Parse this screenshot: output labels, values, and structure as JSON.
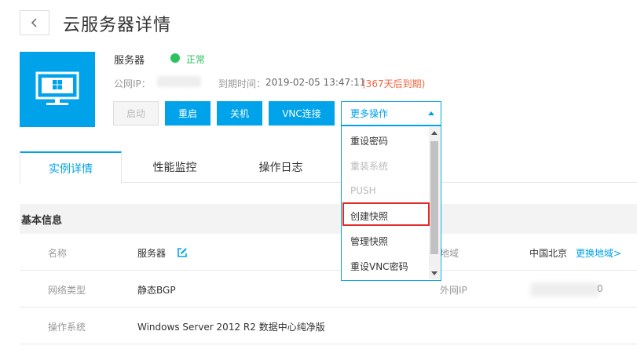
{
  "header": {
    "title": "云服务器详情"
  },
  "server": {
    "name": "服务器",
    "status": "正常",
    "ip_label": "公网IP：",
    "expire_label": "到期时间：",
    "expire_value": "2019-02-05 13:47:11",
    "expire_warn": "(367天后到期)"
  },
  "actions": {
    "start": "启动",
    "restart": "重启",
    "shutdown": "关机",
    "vnc": "VNC连接",
    "more": "更多操作"
  },
  "dropdown": {
    "items": [
      {
        "label": "重设密码",
        "disabled": false
      },
      {
        "label": "重装系统",
        "disabled": true
      },
      {
        "label": "PUSH",
        "disabled": true
      },
      {
        "label": "创建快照",
        "disabled": false
      },
      {
        "label": "管理快照",
        "disabled": false
      },
      {
        "label": "重设VNC密码",
        "disabled": false
      }
    ]
  },
  "tabs": [
    "实例详情",
    "性能监控",
    "操作日志"
  ],
  "section": {
    "title": "基本信息"
  },
  "info": {
    "name_label": "名称",
    "name_value": "服务器",
    "region_label": "地域",
    "region_value": "中国北京",
    "region_link": "更换地域>",
    "net_label": "网络类型",
    "net_value": "静态BGP",
    "extip_label": "外网IP",
    "extip_tail": "0",
    "os_label": "操作系统",
    "os_value": "Windows Server 2012 R2 数据中心纯净版"
  },
  "colors": {
    "accent": "#00a2ea",
    "success": "#2bc25f",
    "warn": "#f5623d",
    "highlight": "#e02b2b"
  },
  "icons": {
    "back": "chevron-left-icon",
    "server": "monitor-windows-icon",
    "edit": "edit-icon"
  }
}
